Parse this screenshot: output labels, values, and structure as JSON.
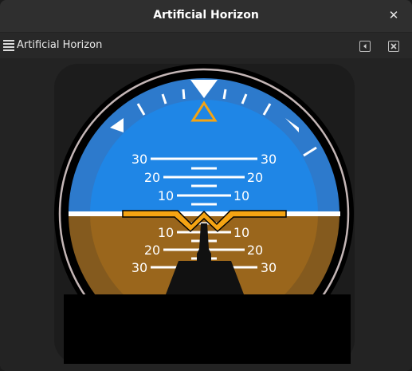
{
  "window": {
    "title": "Artificial Horizon",
    "close_glyph": "✕"
  },
  "toolbar": {
    "label": "Artificial Horizon",
    "menu_icon": "hamburger-menu-icon",
    "detach_icon": "float-panel-icon",
    "close_icon": "close-panel-icon"
  },
  "instrument": {
    "pitch_labels_up": [
      "30",
      "20",
      "10"
    ],
    "pitch_labels_down": [
      "10",
      "20",
      "30"
    ],
    "colors": {
      "sky": "#1f86e6",
      "ground": "#9a661c",
      "aircraft_symbol": "#f5a413",
      "horizon_line": "#ffffff",
      "bezel_ring": "#c4b6b6"
    }
  }
}
